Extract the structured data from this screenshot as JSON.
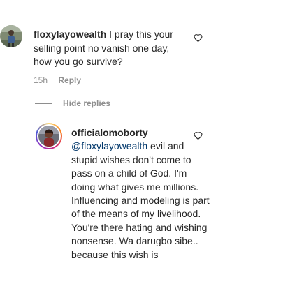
{
  "comment": {
    "username": "floxylayowealth",
    "text": "I pray this your selling point no vanish one day, how you go survive?",
    "time": "15h",
    "reply_label": "Reply",
    "like_icon": "heart-outline-icon"
  },
  "replies_toggle": {
    "label": "Hide replies"
  },
  "reply": {
    "username": "officialomoborty",
    "mention": "@floxylayowealth",
    "text": "evil and stupid wishes don't come to pass on a child of God. I'm doing what gives me millions. Influencing and modeling is part of the means of my livelihood. You're there hating and wishing nonsense. Wa darugbo sibe.. because this wish is",
    "like_icon": "heart-outline-icon"
  },
  "colors": {
    "text": "#262626",
    "secondary": "#8e8e8e",
    "link": "#00376b"
  }
}
